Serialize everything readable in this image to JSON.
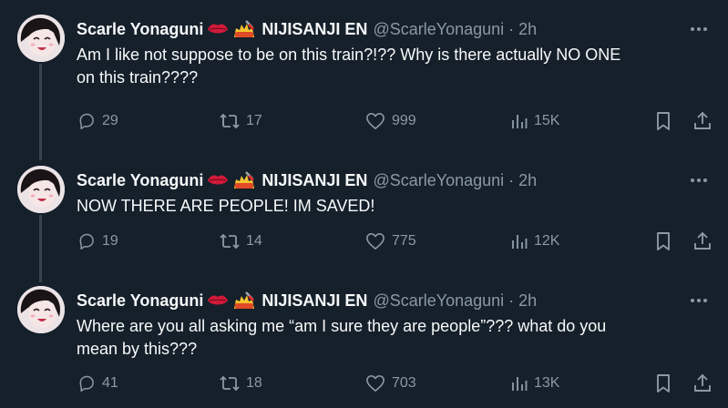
{
  "thread": [
    {
      "author": {
        "name": "Scarle Yonaguni",
        "emojis": [
          "lips-emoji",
          "nail-polish-emoji"
        ],
        "affiliation": "NIJISANJI EN",
        "handle": "@ScarleYonaguni",
        "separator": "·",
        "time": "2h"
      },
      "text_lines": [
        "Am I like not suppose to be on this train?!?? Why is there actually NO ONE",
        "on this train????"
      ],
      "stats": {
        "replies": "29",
        "retweets": "17",
        "likes": "999",
        "views": "15K"
      }
    },
    {
      "author": {
        "name": "Scarle Yonaguni",
        "emojis": [
          "lips-emoji",
          "nail-polish-emoji"
        ],
        "affiliation": "NIJISANJI EN",
        "handle": "@ScarleYonaguni",
        "separator": "·",
        "time": "2h"
      },
      "text_lines": [
        "NOW THERE ARE PEOPLE! IM SAVED!"
      ],
      "stats": {
        "replies": "19",
        "retweets": "14",
        "likes": "775",
        "views": "12K"
      }
    },
    {
      "author": {
        "name": "Scarle Yonaguni",
        "emojis": [
          "lips-emoji",
          "nail-polish-emoji"
        ],
        "affiliation": "NIJISANJI EN",
        "handle": "@ScarleYonaguni",
        "separator": "·",
        "time": "2h"
      },
      "text_lines": [
        "Where are you all asking me “am I sure they are people”??? what do you",
        "mean by this???"
      ],
      "stats": {
        "replies": "41",
        "retweets": "18",
        "likes": "703",
        "views": "13K"
      }
    }
  ],
  "colors": {
    "background": "#15202b",
    "text": "#f7f9f9",
    "muted": "#8b98a5",
    "thread_line": "#38444d"
  }
}
